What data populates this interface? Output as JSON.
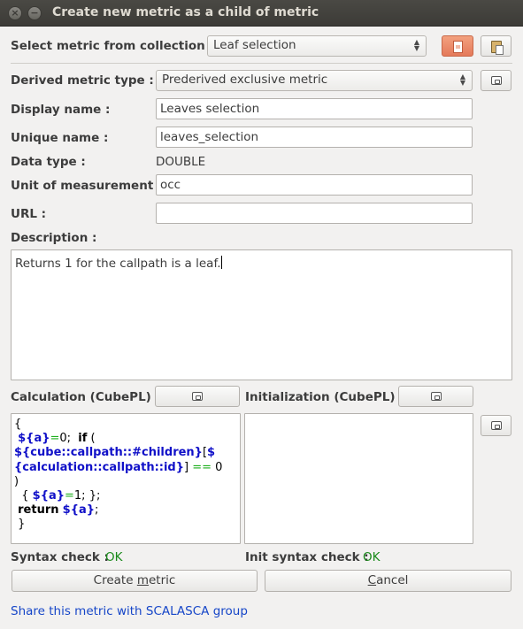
{
  "window": {
    "title": "Create new metric as a child of metric",
    "close_glyph": "×",
    "minimize_glyph": "−"
  },
  "collection": {
    "label": "Select metric from collection :",
    "selected": "Leaf selection"
  },
  "derived_type": {
    "label": "Derived metric type :",
    "selected": "Prederived exclusive metric"
  },
  "display_name": {
    "label": "Display name :",
    "value": "Leaves selection"
  },
  "unique_name": {
    "label": "Unique name :",
    "value": "leaves_selection"
  },
  "data_type": {
    "label": "Data type :",
    "value": "DOUBLE"
  },
  "unit": {
    "label": "Unit of measurement :",
    "value": "occ"
  },
  "url": {
    "label": "URL :",
    "value": ""
  },
  "description": {
    "label": "Description :",
    "value": "Returns 1 for the callpath is a leaf."
  },
  "calculation": {
    "label": "Calculation (CubePL) :",
    "code_lines": [
      [
        {
          "t": "{",
          "c": "plain"
        }
      ],
      [
        {
          "t": " ",
          "c": "plain"
        },
        {
          "t": "${a}",
          "c": "kw"
        },
        {
          "t": "=",
          "c": "eq"
        },
        {
          "t": "0;  ",
          "c": "plain"
        },
        {
          "t": "if",
          "c": "bold"
        },
        {
          "t": " (",
          "c": "plain"
        }
      ],
      [
        {
          "t": "${cube::callpath::#children}",
          "c": "kw"
        },
        {
          "t": "[",
          "c": "plain"
        },
        {
          "t": "$",
          "c": "kw"
        }
      ],
      [
        {
          "t": "{calculation::callpath::id}",
          "c": "kw"
        },
        {
          "t": "] ",
          "c": "plain"
        },
        {
          "t": "==",
          "c": "eq"
        },
        {
          "t": " 0",
          "c": "plain"
        }
      ],
      [
        {
          "t": ")",
          "c": "plain"
        }
      ],
      [
        {
          "t": "  { ",
          "c": "plain"
        },
        {
          "t": "${a}",
          "c": "kw"
        },
        {
          "t": "=",
          "c": "eq"
        },
        {
          "t": "1; };",
          "c": "plain"
        }
      ],
      [
        {
          "t": " ",
          "c": "plain"
        },
        {
          "t": "return",
          "c": "bold"
        },
        {
          "t": " ",
          "c": "plain"
        },
        {
          "t": "${a}",
          "c": "kw"
        },
        {
          "t": ";",
          "c": "plain"
        }
      ],
      [
        {
          "t": " }",
          "c": "plain"
        }
      ]
    ]
  },
  "initialization": {
    "label": "Initialization (CubePL) :",
    "code": ""
  },
  "syntax_check": {
    "label": "Syntax check :",
    "status": "OK"
  },
  "init_syntax_check": {
    "label": "Init syntax check :",
    "status": "OK"
  },
  "buttons": {
    "create_pre": "Create ",
    "create_mnemonic": "m",
    "create_post": "etric",
    "cancel_mnemonic": "C",
    "cancel_post": "ancel"
  },
  "share_link": "Share this metric with SCALASCA group",
  "icons": {
    "new_doc": "new-document-icon",
    "paste": "paste-icon",
    "edit": "edit-icon"
  }
}
